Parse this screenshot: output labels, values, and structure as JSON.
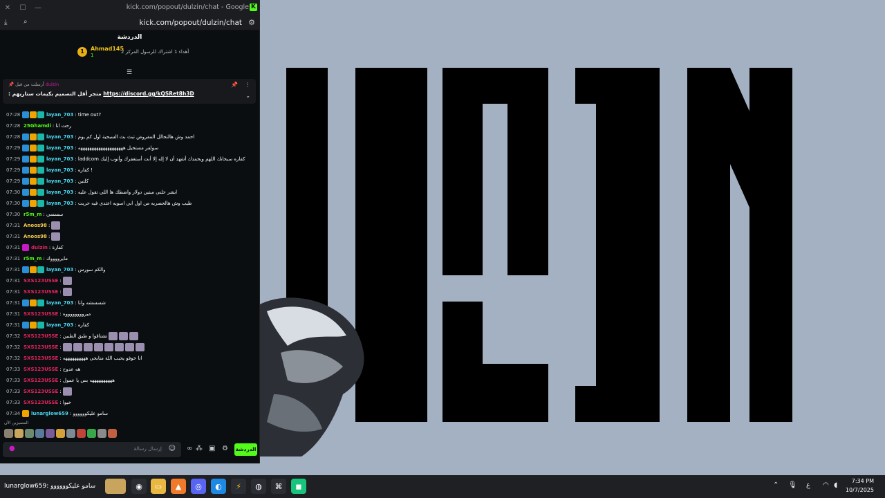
{
  "window": {
    "title": "kick.com/popout/dulzin/chat - Google Chrome",
    "url": "kick.com/popout/dulzin/chat"
  },
  "chat": {
    "header": "الدردشة",
    "gift": {
      "rank": "1",
      "user": "Ahmad145",
      "count": "1",
      "text": "أهداء 1 اشتراك للرسول المركز 2"
    },
    "pinned": {
      "pinned_by": "أرسلت من قبل",
      "pinned_user": "dulzin",
      "text": ": متجر أقل التصميم بكيمات ستاريهم",
      "link": "https://discord.gg/kQSRet8h3D"
    },
    "messages": [
      {
        "time": "07:28",
        "badges": [
          "blue",
          "gold",
          "teal"
        ],
        "user": "layan_703",
        "user_color": "#4ad8f2",
        "text": ": time out?",
        "emotes": 0
      },
      {
        "time": "07:28",
        "badges": [],
        "user": "25Ghamdi",
        "user_color": "#53fc18",
        "text": ": رحت انا",
        "emotes": 0
      },
      {
        "time": "07:28",
        "badges": [
          "blue",
          "gold",
          "teal"
        ],
        "user": "layan_703",
        "user_color": "#4ad8f2",
        "text": ": احمد وش هالتحالل المفروض تبث بث السبحية اول كم يوم",
        "emotes": 0
      },
      {
        "time": "07:29",
        "badges": [
          "blue",
          "gold",
          "teal"
        ],
        "user": "layan_703",
        "user_color": "#4ad8f2",
        "text": ": سولفر مستحيل ههههههههههههههههههههه",
        "emotes": 0
      },
      {
        "time": "07:29",
        "badges": [
          "blue",
          "gold",
          "teal"
        ],
        "user": "layan_703",
        "user_color": "#4ad8f2",
        "text": ": laddcom كفاره سبحانك اللهم وبحمدك أشهد أن لا إله إلا أنت أستغفرك وأتوب إليك",
        "emotes": 0
      },
      {
        "time": "07:29",
        "badges": [
          "blue",
          "gold",
          "teal"
        ],
        "user": "layan_703",
        "user_color": "#4ad8f2",
        "text": ": كفاره !",
        "emotes": 0
      },
      {
        "time": "07:29",
        "badges": [
          "blue",
          "gold",
          "teal"
        ],
        "user": "layan_703",
        "user_color": "#4ad8f2",
        "text": ": كلتين",
        "emotes": 0
      },
      {
        "time": "07:30",
        "badges": [
          "blue",
          "gold",
          "teal"
        ],
        "user": "layan_703",
        "user_color": "#4ad8f2",
        "text": ": ابشر حلنى مبتين دولار واضطك ها اللي تقول عليه",
        "emotes": 0
      },
      {
        "time": "07:30",
        "badges": [
          "blue",
          "gold",
          "teal"
        ],
        "user": "layan_703",
        "user_color": "#4ad8f2",
        "text": ": طيب وش هالحصريه من اول ابي اسويه اعتدى فيه حريت",
        "emotes": 0
      },
      {
        "time": "07:30",
        "badges": [],
        "user": "r5m_m",
        "user_color": "#53fc18",
        "text": ": سسسي",
        "emotes": 0
      },
      {
        "time": "07:31",
        "badges": [],
        "user": "Anoos98",
        "user_color": "#f2c94c",
        "text": ":",
        "emotes": 1
      },
      {
        "time": "07:31",
        "badges": [],
        "user": "Anoos98",
        "user_color": "#f2c94c",
        "text": ":",
        "emotes": 1
      },
      {
        "time": "07:31",
        "badges": [
          "pink"
        ],
        "user": "dulzin",
        "user_color": "#e0245e",
        "text": ": كفارة",
        "emotes": 0
      },
      {
        "time": "07:31",
        "badges": [],
        "user": "r5m_m",
        "user_color": "#53fc18",
        "text": ": مايرووووك",
        "emotes": 0
      },
      {
        "time": "07:31",
        "badges": [
          "blue",
          "gold",
          "teal"
        ],
        "user": "layan_703",
        "user_color": "#4ad8f2",
        "text": ": والكم سورس",
        "emotes": 0
      },
      {
        "time": "07:31",
        "badges": [],
        "user": "SXS123USSE",
        "user_color": "#e0245e",
        "text": ":",
        "emotes": 1
      },
      {
        "time": "07:31",
        "badges": [],
        "user": "SXS123USSE",
        "user_color": "#e0245e",
        "text": ":",
        "emotes": 1
      },
      {
        "time": "07:31",
        "badges": [
          "blue",
          "gold",
          "teal"
        ],
        "user": "layan_703",
        "user_color": "#4ad8f2",
        "text": ": شسسشه وانا",
        "emotes": 0
      },
      {
        "time": "07:31",
        "badges": [],
        "user": "SXS123USSE",
        "user_color": "#e0245e",
        "text": ": ميرووووووووه",
        "emotes": 0
      },
      {
        "time": "07:31",
        "badges": [
          "blue",
          "gold",
          "teal"
        ],
        "user": "layan_703",
        "user_color": "#4ad8f2",
        "text": ": كفاره",
        "emotes": 0
      },
      {
        "time": "07:32",
        "badges": [],
        "user": "SXS123USSE",
        "user_color": "#e0245e",
        "text": ": تشتاقوا و طبق الطبين",
        "emotes": 3
      },
      {
        "time": "07:32",
        "badges": [],
        "user": "SXS123USSE",
        "user_color": "#e0245e",
        "text": ":",
        "emotes": 8
      },
      {
        "time": "07:32",
        "badges": [],
        "user": "SXS123USSE",
        "user_color": "#e0245e",
        "text": ": انا خوفو يحبب اللة منابحى ههههههههههه",
        "emotes": 0
      },
      {
        "time": "07:33",
        "badges": [],
        "user": "SXS123USSE",
        "user_color": "#e0245e",
        "text": ": هه عدوح",
        "emotes": 0
      },
      {
        "time": "07:33",
        "badges": [],
        "user": "SXS123USSE",
        "user_color": "#e0245e",
        "text": ": ههههههههههه بس يا عمول",
        "emotes": 0
      },
      {
        "time": "07:33",
        "badges": [],
        "user": "SXS123USSE",
        "user_color": "#e0245e",
        "text": ":",
        "emotes": 1
      },
      {
        "time": "07:33",
        "badges": [],
        "user": "SXS123USSE",
        "user_color": "#e0245e",
        "text": ": خبوا",
        "emotes": 0
      },
      {
        "time": "07:34",
        "badges": [
          "gold"
        ],
        "user": "lunarglow659",
        "user_color": "#4ad8f2",
        "text": ": سامو عليكوووووو",
        "emotes": 0
      }
    ],
    "emote_bar_label": "المتميزين الآن",
    "input_placeholder": "إرسال رسالة",
    "send_label": "الدردشة"
  },
  "taskbar": {
    "preview_text": "lunarglow659: سامو عليكوووووو",
    "time": "7:34 PM",
    "date": "10/7/2025",
    "lang": "ع"
  },
  "colors": {
    "kick_green": "#53fc18",
    "desktop_bg": "#a3b1c2",
    "chat_bg": "#0b0e10"
  }
}
